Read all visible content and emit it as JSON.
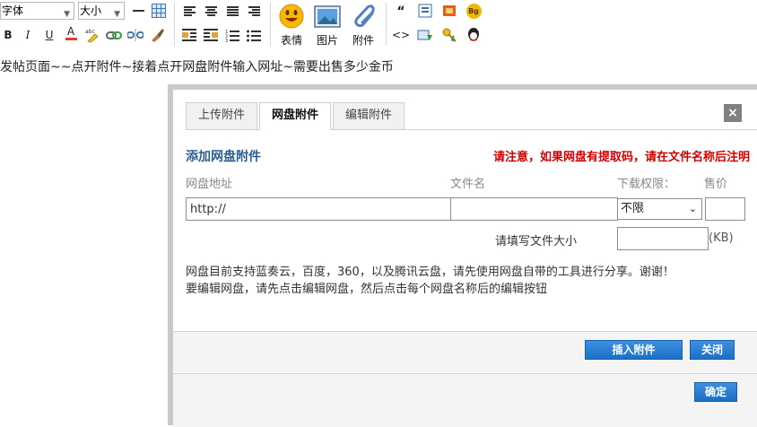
{
  "toolbar": {
    "font_select": "字体",
    "size_select": "大小",
    "emoji_label": "表情",
    "image_label": "图片",
    "attach_label": "附件",
    "bold": "B",
    "italic": "I",
    "underline": "U",
    "font_color": "A",
    "quote": "“",
    "code": "<>",
    "bg_badge": "Bg"
  },
  "prompt": "发帖页面~~点开附件~接着点开网盘附件输入网址~需要出售多少金币",
  "dialog": {
    "tabs": [
      {
        "label": "上传附件",
        "active": false
      },
      {
        "label": "网盘附件",
        "active": true
      },
      {
        "label": "编辑附件",
        "active": false
      }
    ],
    "close": "×",
    "section_title": "添加网盘附件",
    "notice": "请注意，如果网盘有提取码，请在文件名称后注明",
    "columns": {
      "url": "网盘地址",
      "filename": "文件名",
      "permission": "下载权限：",
      "price": "售价"
    },
    "url_value": "http://",
    "filename_value": "",
    "permission_value": "不限",
    "price_value": "",
    "size_label": "请填写文件大小",
    "size_value": "",
    "size_unit": "(KB)",
    "help_line1": "网盘目前支持蓝奏云，百度，360，以及腾讯云盘，请先使用网盘自带的工具进行分享。谢谢！",
    "help_line2": "要编辑网盘，请先点击编辑网盘，然后点击每个网盘名称后的编辑按钮",
    "insert_button": "插入附件",
    "close_button": "关闭",
    "confirm_button": "确定"
  },
  "colors": {
    "title_blue": "#2a5e8f",
    "notice_red": "#d40000",
    "button_blue": "#1b6fc7"
  }
}
